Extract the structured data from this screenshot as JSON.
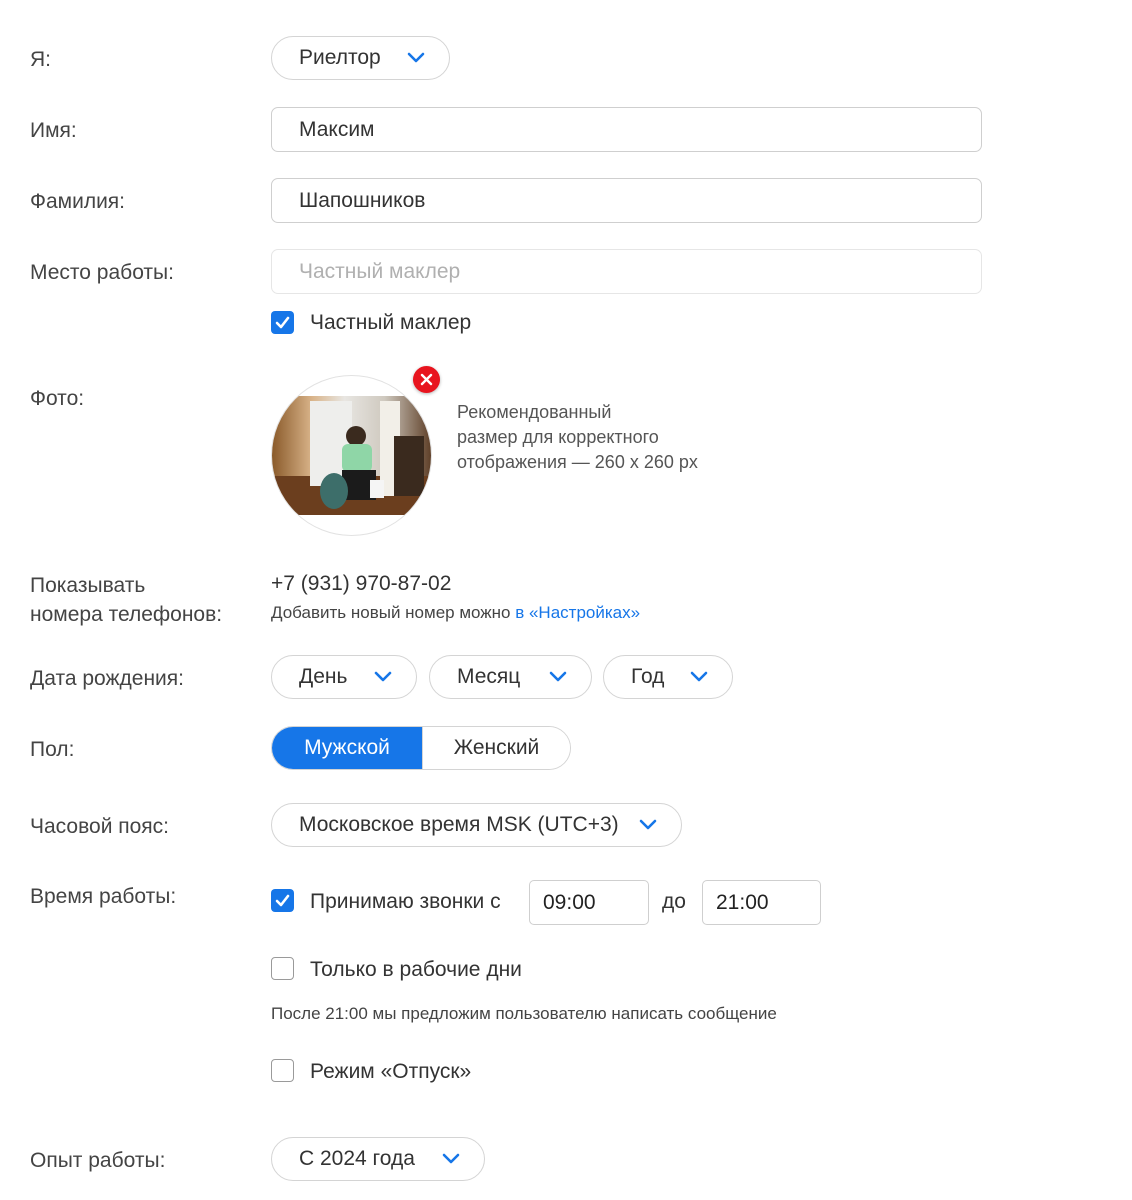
{
  "role": {
    "label": "Я:",
    "value": "Риелтор"
  },
  "first_name": {
    "label": "Имя:",
    "value": "Максим"
  },
  "last_name": {
    "label": "Фамилия:",
    "value": "Шапошников"
  },
  "workplace": {
    "label": "Место работы:",
    "placeholder": "Частный маклер",
    "private_broker_checkbox": {
      "label": "Частный маклер",
      "checked": true
    }
  },
  "photo": {
    "label": "Фото:",
    "hint_lines": [
      "Рекомендованный",
      "размер для корректного",
      "отображения — 260 x 260 px"
    ]
  },
  "phones": {
    "label_line1": "Показывать",
    "label_line2": "номера телефонов:",
    "number": "+7 (931) 970-87-02",
    "note": "Добавить новый номер можно ",
    "note_link": "в «Настройках»"
  },
  "birthdate": {
    "label": "Дата рождения:",
    "day": "День",
    "month": "Месяц",
    "year": "Год"
  },
  "gender": {
    "label": "Пол:",
    "options": [
      "Мужской",
      "Женский"
    ],
    "selected": "Мужской"
  },
  "timezone": {
    "label": "Часовой пояс:",
    "value": "Московское время MSK (UTC+3)"
  },
  "work_hours": {
    "label": "Время работы:",
    "accept_calls": {
      "label": "Принимаю звонки с",
      "checked": true
    },
    "from": "09:00",
    "to_label": "до",
    "to": "21:00",
    "weekdays_only": {
      "label": "Только в рабочие дни",
      "checked": false
    },
    "after_note": "После 21:00 мы предложим пользователю написать сообщение",
    "vacation": {
      "label": "Режим «Отпуск»",
      "checked": false
    }
  },
  "experience": {
    "label": "Опыт работы:",
    "value": "С 2024 года"
  },
  "colors": {
    "accent": "#1676e8",
    "remove": "#e8141e",
    "border": "#d4d4d4"
  }
}
